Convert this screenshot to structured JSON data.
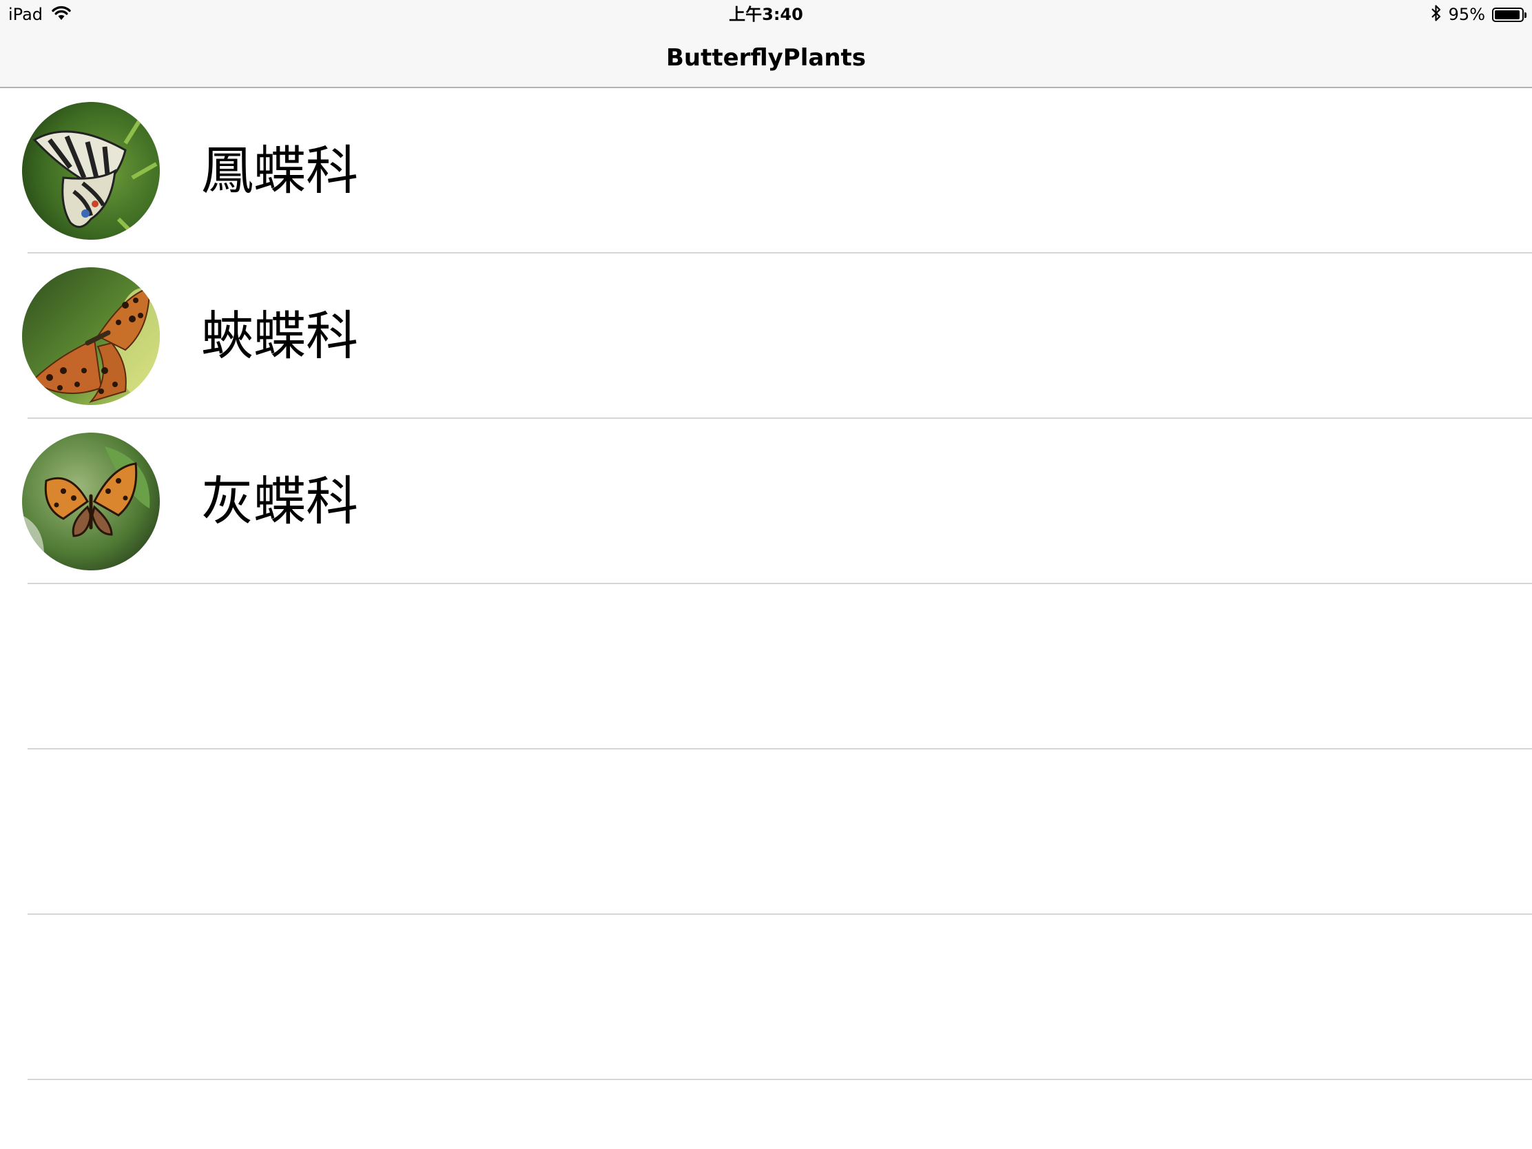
{
  "status_bar": {
    "device": "iPad",
    "time": "上午3:40",
    "battery_percent": "95%",
    "battery_level": 0.95,
    "icons": [
      "wifi-icon",
      "bluetooth-icon",
      "battery-icon"
    ]
  },
  "nav": {
    "title": "ButterflyPlants"
  },
  "families": [
    {
      "label": "鳳蝶科",
      "thumbnail": "swallowtail-butterfly-photo"
    },
    {
      "label": "蛺蝶科",
      "thumbnail": "fritillary-butterfly-photo"
    },
    {
      "label": "灰蝶科",
      "thumbnail": "copper-butterfly-photo"
    }
  ],
  "colors": {
    "nav_background": "#f7f7f7",
    "separator": "#d6d6d9",
    "text": "#000000"
  }
}
